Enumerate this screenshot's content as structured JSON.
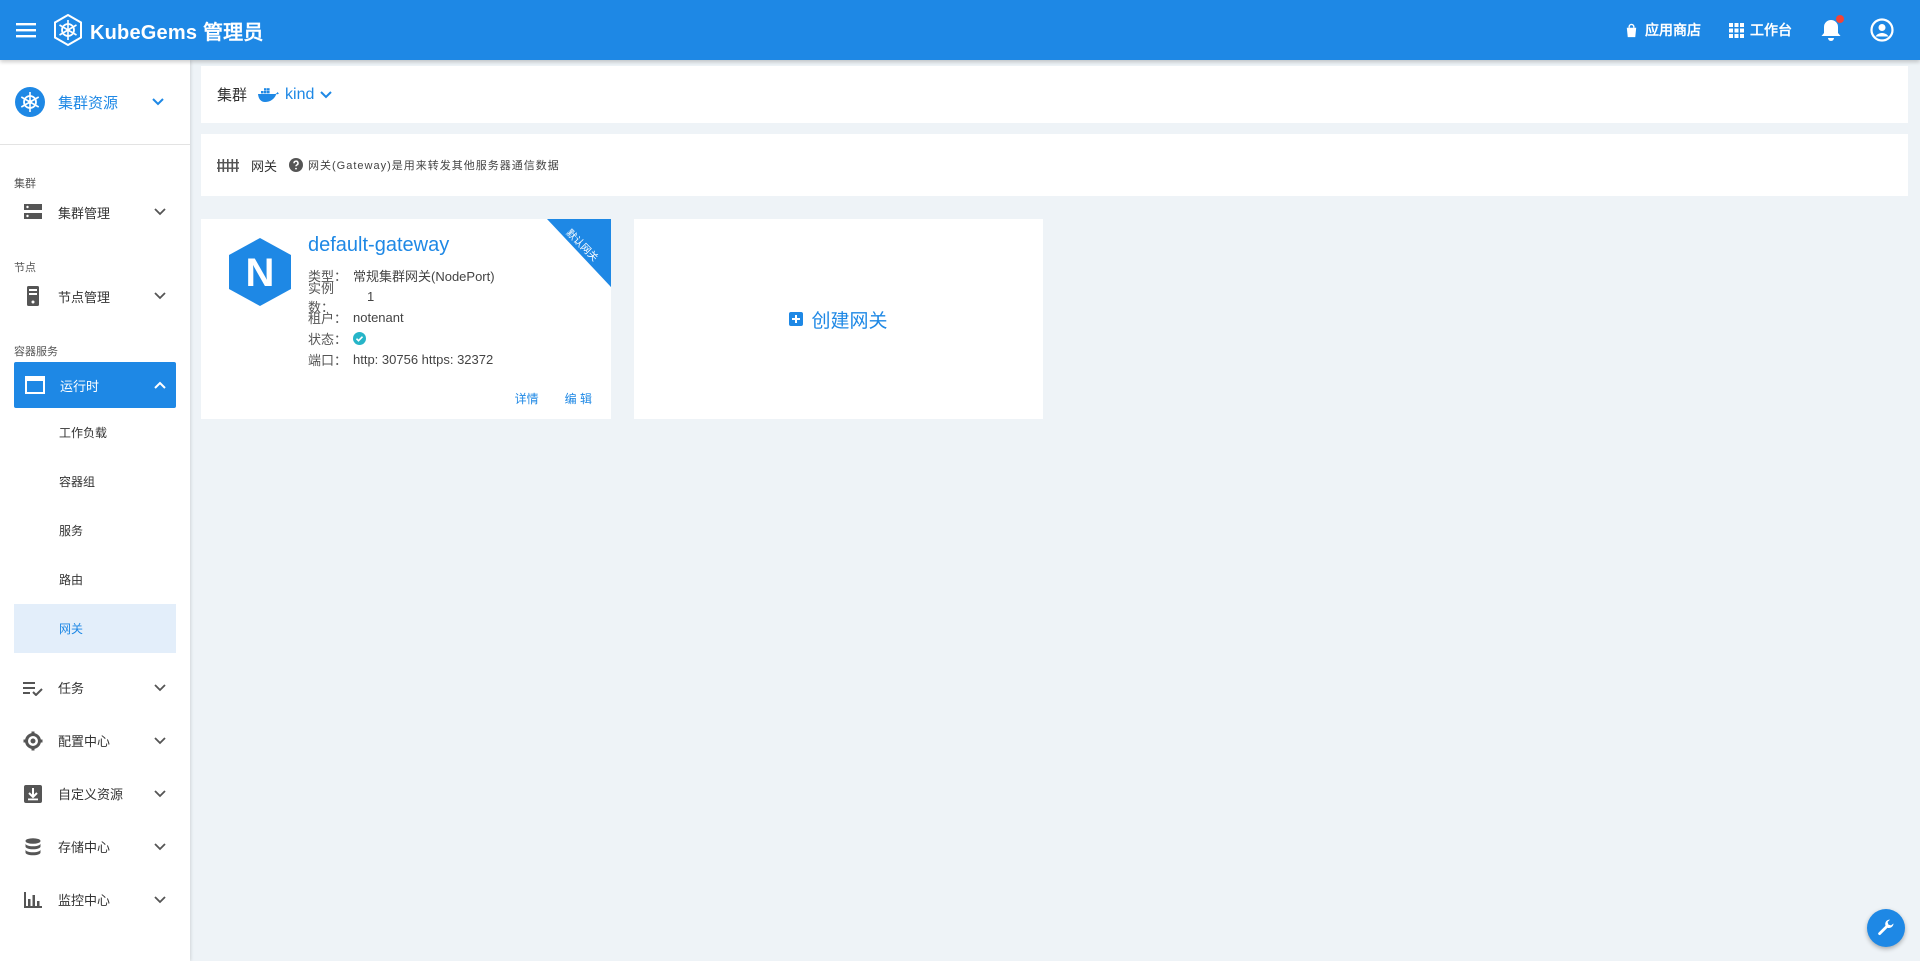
{
  "topbar": {
    "brand": "KubeGems 管理员",
    "app_store": "应用商店",
    "workbench": "工作台"
  },
  "sidebar": {
    "resource_switch": "集群资源",
    "sections": {
      "cluster": "集群",
      "node": "节点",
      "container": "容器服务"
    },
    "items": {
      "cluster_mgmt": "集群管理",
      "node_mgmt": "节点管理",
      "runtime": "运行时",
      "workload": "工作负载",
      "pod": "容器组",
      "service": "服务",
      "route": "路由",
      "gateway": "网关",
      "task": "任务",
      "config": "配置中心",
      "crd": "自定义资源",
      "storage": "存储中心",
      "monitor": "监控中心"
    }
  },
  "cluster_bar": {
    "label": "集群",
    "value": "kind"
  },
  "title_bar": {
    "name": "网关",
    "tip": "网关(Gateway)是用来转发其他服务器通信数据"
  },
  "gateway": {
    "name": "default-gateway",
    "ribbon": "默认网关",
    "logo_letter": "N",
    "rows": {
      "type_label": "类型：",
      "type_value": "常规集群网关(NodePort)",
      "replicas_label": "实例数：",
      "replicas_value": "1",
      "tenant_label": "租户：",
      "tenant_value": "notenant",
      "status_label": "状态：",
      "port_label": "端口：",
      "port_value": "http: 30756 https: 32372"
    },
    "detail": "详情",
    "edit": "编 辑"
  },
  "create_card": {
    "label": "创建网关"
  },
  "colors": {
    "primary": "#1e88e5",
    "status_ok": "#26b5c8",
    "notification": "#f44336"
  }
}
